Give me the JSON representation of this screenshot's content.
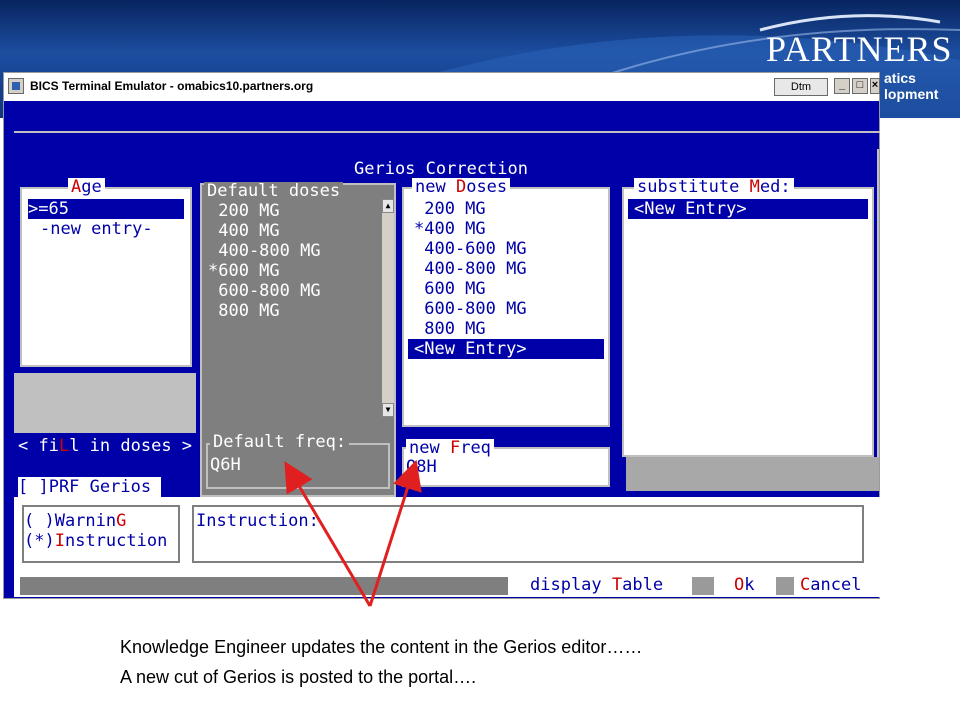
{
  "brand": {
    "logo_text": "PARTNERS",
    "sub_line1": "atics",
    "sub_line2": "lopment"
  },
  "window": {
    "title": "BICS Terminal Emulator - omabics10.partners.org",
    "dtm_label": "Dtm",
    "btn_min": "_",
    "btn_max": "□",
    "btn_close": "×"
  },
  "editor": {
    "title": "Gerios Correction",
    "age": {
      "label_pre": "",
      "label_hot": "A",
      "label_post": "ge",
      "items": [
        ">=65",
        "-new entry-"
      ],
      "selected_index": 0
    },
    "default_doses": {
      "label": "Default doses",
      "items": [
        " 200 MG",
        " 400 MG",
        " 400-800 MG",
        "*600 MG",
        " 600-800 MG",
        " 800 MG"
      ]
    },
    "new_doses": {
      "label_pre": "new ",
      "label_hot": "D",
      "label_post": "oses",
      "items": [
        " 200 MG",
        "*400 MG",
        " 400-600 MG",
        " 400-800 MG",
        " 600 MG",
        " 600-800 MG",
        " 800 MG",
        "<New Entry>"
      ],
      "selected_index": 7
    },
    "substitute_med": {
      "label_pre": "substitute ",
      "label_hot": "M",
      "label_post": "ed:",
      "items": [
        "<New Entry>"
      ],
      "selected_index": 0
    },
    "fill_in_doses": {
      "pre": "< fi",
      "hot": "L",
      "post": "l in doses >"
    },
    "default_freq": {
      "label": "Default freq:",
      "value": "Q6H"
    },
    "new_freq": {
      "label_pre": "new ",
      "label_hot": "F",
      "label_post": "req",
      "value": "Q8H"
    },
    "prf": {
      "pre": "[ ]PRF Gerios"
    },
    "options": [
      {
        "pre": "( )Warnin",
        "hot": "G",
        "post": ""
      },
      {
        "pre": "(*)",
        "hot": "I",
        "post": "nstruction"
      }
    ],
    "instruction_label": "Instruction:",
    "buttons": {
      "display_pre": "display ",
      "display_hot": "T",
      "display_post": "able",
      "ok_pre": "",
      "ok_hot": "O",
      "ok_post": "k",
      "cancel_pre": "",
      "cancel_hot": "C",
      "cancel_post": "ancel"
    }
  },
  "captions": [
    "Knowledge Engineer updates the content in the Gerios editor……",
    "A new cut of Gerios is posted to the portal…."
  ],
  "colors": {
    "terminal_bg": "#0000a8",
    "hotkey": "#cc0000",
    "arrow": "#e02020",
    "banner": "#1c4ea0"
  }
}
